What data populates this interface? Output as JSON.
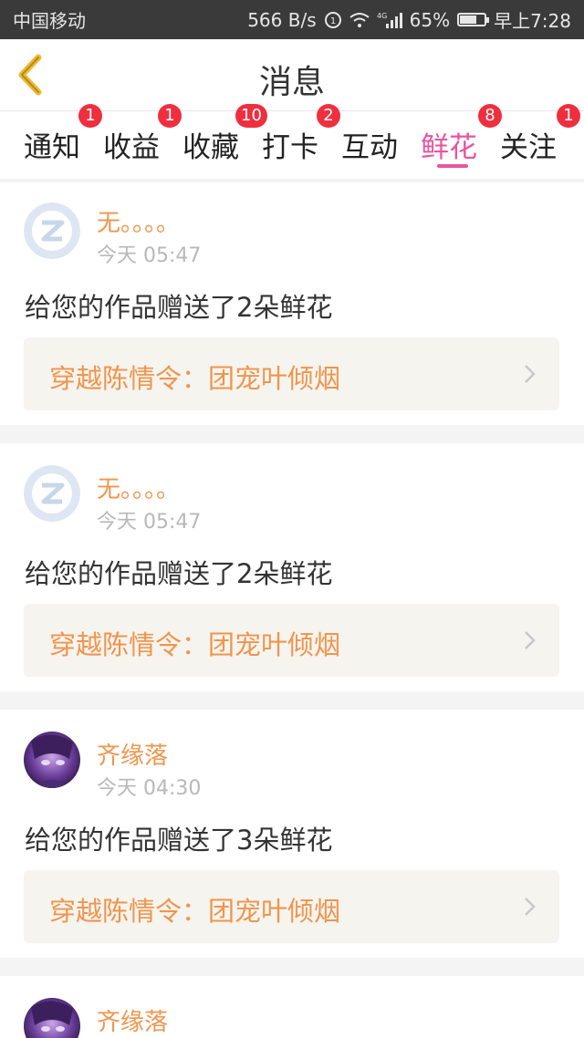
{
  "status_bar": {
    "carrier": "中国移动",
    "network_speed": "566 B/s",
    "battery_percent": "65%",
    "time": "早上7:28",
    "signal_label": "4G"
  },
  "header": {
    "title": "消息"
  },
  "tabs": [
    {
      "label": "通知",
      "badge": "1"
    },
    {
      "label": "收益",
      "badge": "1"
    },
    {
      "label": "收藏",
      "badge": "10"
    },
    {
      "label": "打卡",
      "badge": "2"
    },
    {
      "label": "互动",
      "badge": ""
    },
    {
      "label": "鲜花",
      "badge": "8"
    },
    {
      "label": "关注",
      "badge": "1"
    }
  ],
  "active_tab": "鲜花",
  "messages": [
    {
      "user": "无。。。。",
      "time": "今天 05:47",
      "text": "给您的作品赠送了2朵鲜花",
      "work": "穿越陈情令：团宠叶倾烟"
    },
    {
      "user": "无。。。。",
      "time": "今天 05:47",
      "text": "给您的作品赠送了2朵鲜花",
      "work": "穿越陈情令：团宠叶倾烟"
    },
    {
      "user": "齐缘落",
      "time": "今天 04:30",
      "text": "给您的作品赠送了3朵鲜花",
      "work": "穿越陈情令：团宠叶倾烟"
    },
    {
      "user": "齐缘落",
      "time": "",
      "text": "",
      "work": ""
    }
  ],
  "colors": {
    "accent_pink": "#e8549e",
    "username_orange": "#f0954c",
    "badge_red": "#ef2f3e"
  }
}
